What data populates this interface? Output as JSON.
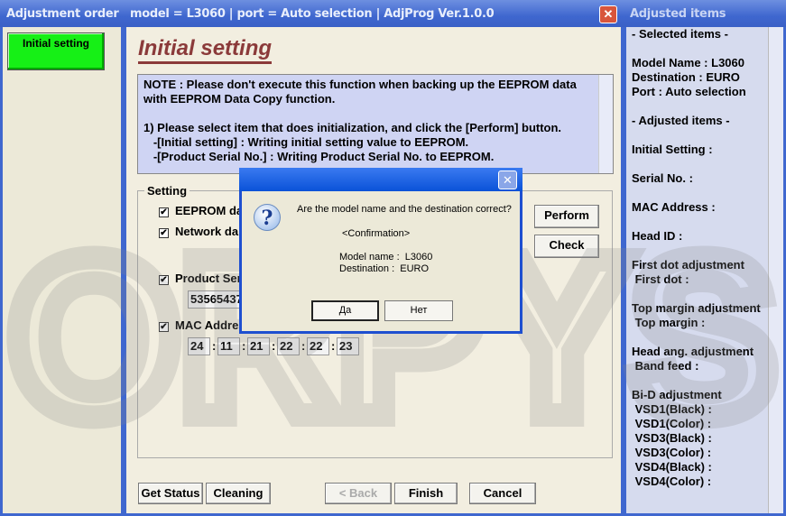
{
  "left": {
    "title": "Adjustment order",
    "items": [
      {
        "label": "Initial setting"
      }
    ]
  },
  "main": {
    "title": "model = L3060 | port = Auto selection | AdjProg Ver.1.0.0",
    "heading": "Initial setting",
    "note": [
      "NOTE : Please don't execute this function when backing up the EEPROM data",
      "with EEPROM Data Copy function.",
      "",
      "1) Please select item that does initialization, and click the [Perform] button.",
      "   -[Initial setting] : Writing initial setting value to EEPROM.",
      "   -[Product Serial No.] : Writing Product Serial No. to EEPROM."
    ],
    "setting_label": "Setting",
    "checkboxes": [
      {
        "label": "EEPROM da",
        "checked": true
      },
      {
        "label": "Network da",
        "checked": true
      },
      {
        "label": "Product Ser",
        "checked": true
      },
      {
        "label": "MAC Addres",
        "checked": true
      }
    ],
    "serial_value": "53565437",
    "mac": [
      "24",
      "11",
      "21",
      "22",
      "22",
      "23"
    ],
    "perform": "Perform",
    "check": "Check",
    "footer": {
      "get_status": "Get Status",
      "cleaning": "Cleaning",
      "back": "< Back",
      "finish": "Finish",
      "cancel": "Cancel"
    }
  },
  "dialog": {
    "question": "Are the model name and the destination correct?",
    "confirmation": "<Confirmation>",
    "model_line": "Model name :  L3060",
    "dest_line": "Destination :  EURO",
    "yes": "Да",
    "no": "Нет"
  },
  "right": {
    "title": "Adjusted items",
    "lines": [
      "- Selected items -",
      "",
      "Model Name : L3060",
      "Destination : EURO",
      "Port : Auto selection",
      "",
      "- Adjusted items -",
      "",
      "Initial Setting :",
      "",
      "Serial No. :",
      "",
      "MAC Address :",
      "",
      "Head ID :",
      "",
      "First dot adjustment",
      " First dot :",
      "",
      "Top margin adjustment",
      " Top margin :",
      "",
      "Head ang. adjustment",
      " Band feed :",
      "",
      "Bi-D adjustment",
      " VSD1(Black) :",
      " VSD1(Color) :",
      " VSD3(Black) :",
      " VSD3(Color) :",
      " VSD4(Black) :",
      " VSD4(Color) :"
    ]
  },
  "watermark": "ORPYS"
}
